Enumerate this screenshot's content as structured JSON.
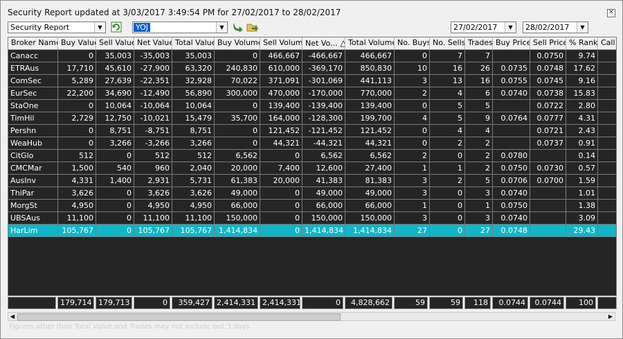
{
  "title": "Security Report updated at 3/03/2017 3:49:54 PM for 27/02/2017 to 28/02/2017",
  "toolbar": {
    "report_type": "Security Report",
    "security_code": "YOJ",
    "date_from": "27/02/2017",
    "date_to": "28/02/2017"
  },
  "icons": {
    "refresh": "refresh-icon",
    "go": "go-arrow-icon",
    "export": "export-icon",
    "close": "close-icon"
  },
  "columns": [
    "Broker Name",
    "Buy Value",
    "Sell Value",
    "Net Value",
    "Total Value",
    "Buy Volume",
    "Sell Volume",
    "Net Vo...",
    "Total Volume",
    "No. Buys",
    "No. Sells",
    "Trades",
    "Buy Price",
    "Sell Price",
    "% Rank",
    "Call"
  ],
  "sort_indicator": "△",
  "rows": [
    [
      "Canacc",
      "0",
      "35,003",
      "-35,003",
      "35,003",
      "0",
      "466,667",
      "-466,667",
      "466,667",
      "0",
      "7",
      "7",
      "",
      "0.0750",
      "9.74",
      ""
    ],
    [
      "ETRAus",
      "17,710",
      "45,610",
      "-27,900",
      "63,320",
      "240,830",
      "610,000",
      "-369,170",
      "850,830",
      "10",
      "16",
      "26",
      "0.0735",
      "0.0748",
      "17.62",
      ""
    ],
    [
      "ComSec",
      "5,289",
      "27,639",
      "-22,351",
      "32,928",
      "70,022",
      "371,091",
      "-301,069",
      "441,113",
      "3",
      "13",
      "16",
      "0.0755",
      "0.0745",
      "9.16",
      ""
    ],
    [
      "EurSec",
      "22,200",
      "34,690",
      "-12,490",
      "56,890",
      "300,000",
      "470,000",
      "-170,000",
      "770,000",
      "2",
      "4",
      "6",
      "0.0740",
      "0.0738",
      "15.83",
      ""
    ],
    [
      "StaOne",
      "0",
      "10,064",
      "-10,064",
      "10,064",
      "0",
      "139,400",
      "-139,400",
      "139,400",
      "0",
      "5",
      "5",
      "",
      "0.0722",
      "2.80",
      ""
    ],
    [
      "TimHil",
      "2,729",
      "12,750",
      "-10,021",
      "15,479",
      "35,700",
      "164,000",
      "-128,300",
      "199,700",
      "4",
      "5",
      "9",
      "0.0764",
      "0.0777",
      "4.31",
      ""
    ],
    [
      "Pershn",
      "0",
      "8,751",
      "-8,751",
      "8,751",
      "0",
      "121,452",
      "-121,452",
      "121,452",
      "0",
      "4",
      "4",
      "",
      "0.0721",
      "2.43",
      ""
    ],
    [
      "WeaHub",
      "0",
      "3,266",
      "-3,266",
      "3,266",
      "0",
      "44,321",
      "-44,321",
      "44,321",
      "0",
      "2",
      "2",
      "",
      "0.0737",
      "0.91",
      ""
    ],
    [
      "CitGlo",
      "512",
      "0",
      "512",
      "512",
      "6,562",
      "0",
      "6,562",
      "6,562",
      "2",
      "0",
      "2",
      "0.0780",
      "",
      "0.14",
      ""
    ],
    [
      "CMCMar",
      "1,500",
      "540",
      "960",
      "2,040",
      "20,000",
      "7,400",
      "12,600",
      "27,400",
      "1",
      "1",
      "2",
      "0.0750",
      "0.0730",
      "0.57",
      ""
    ],
    [
      "AusInv",
      "4,331",
      "1,400",
      "2,931",
      "5,731",
      "61,383",
      "20,000",
      "41,383",
      "81,383",
      "3",
      "2",
      "5",
      "0.0706",
      "0.0700",
      "1.59",
      ""
    ],
    [
      "ThiPar",
      "3,626",
      "0",
      "3,626",
      "3,626",
      "49,000",
      "0",
      "49,000",
      "49,000",
      "3",
      "0",
      "3",
      "0.0740",
      "",
      "1.01",
      ""
    ],
    [
      "MorgSt",
      "4,950",
      "0",
      "4,950",
      "4,950",
      "66,000",
      "0",
      "66,000",
      "66,000",
      "1",
      "0",
      "1",
      "0.0750",
      "",
      "1.38",
      ""
    ],
    [
      "UBSAus",
      "11,100",
      "0",
      "11,100",
      "11,100",
      "150,000",
      "0",
      "150,000",
      "150,000",
      "3",
      "0",
      "3",
      "0.0740",
      "",
      "3.09",
      ""
    ],
    [
      "HarLim",
      "105,767",
      "0",
      "105,767",
      "105,767",
      "1,414,834",
      "0",
      "1,414,834",
      "1,414,834",
      "27",
      "0",
      "27",
      "0.0748",
      "",
      "29.43",
      ""
    ]
  ],
  "selected_row_index": 14,
  "totals": [
    "",
    "179,714",
    "179,713",
    "0",
    "359,427",
    "2,414,331",
    "2,414,331",
    "0",
    "4,828,662",
    "59",
    "59",
    "118",
    "0.0744",
    "0.0744",
    "100",
    ""
  ],
  "footnote": "Figures other than Total Value and Trades may not include last 3 days",
  "colors": {
    "grid_bg": "#252525",
    "selected_row": "#12b5c8",
    "header_bg": "#f0f0f0"
  }
}
